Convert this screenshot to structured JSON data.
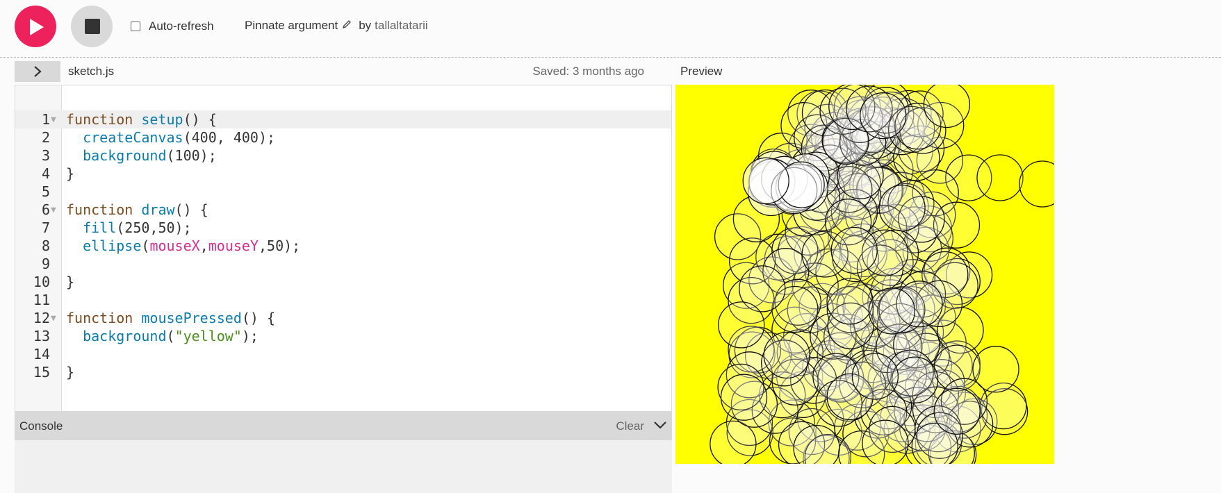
{
  "toolbar": {
    "play_icon": "play-icon",
    "stop_icon": "stop-icon",
    "auto_refresh_label": "Auto-refresh",
    "auto_refresh_checked": false,
    "project_name": "Pinnate argument",
    "by_label": "by",
    "author": "tallaltatarii"
  },
  "editor": {
    "expand_icon": "chevron-right-icon",
    "filename": "sketch.js",
    "saved_status": "Saved: 3 months ago",
    "lines": [
      "1",
      "2",
      "3",
      "4",
      "5",
      "6",
      "7",
      "8",
      "9",
      "10",
      "11",
      "12",
      "13",
      "14",
      "15"
    ]
  },
  "console": {
    "label": "Console",
    "clear_label": "Clear",
    "collapse_icon": "chevron-down-icon"
  },
  "preview": {
    "label": "Preview",
    "background_color": "#ffff00",
    "fill_color": "#fafa32"
  },
  "colors": {
    "accent": "#ed225d",
    "keyword": "#7a4b1f",
    "function": "#0b7ca9",
    "variable": "#d52f8e",
    "string": "#4e8e1e"
  }
}
